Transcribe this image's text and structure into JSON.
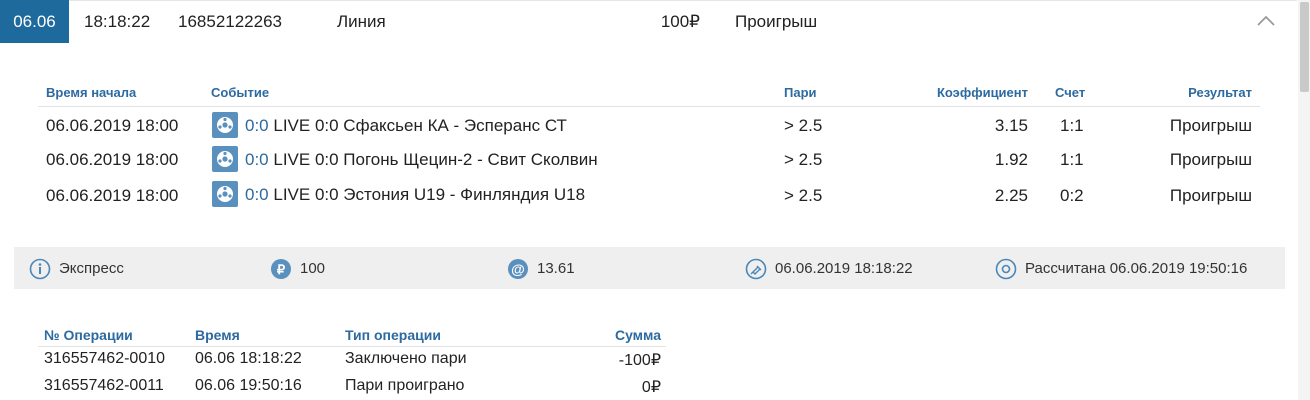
{
  "header": {
    "date": "06.06",
    "time": "18:18:22",
    "bet_id": "16852122263",
    "type": "Линия",
    "amount": "100₽",
    "result": "Проигрыш"
  },
  "events": {
    "columns": {
      "start": "Время начала",
      "event": "Событие",
      "bet": "Пари",
      "coef": "Коэффициент",
      "score": "Счет",
      "result": "Результат"
    },
    "rows": [
      {
        "start": "06.06.2019 18:00",
        "score_live": "0:0",
        "name": "LIVE 0:0 Сфаксьен КА - Эсперанс СТ",
        "bet": "> 2.5",
        "coef": "3.15",
        "score": "1:1",
        "result": "Проигрыш"
      },
      {
        "start": "06.06.2019 18:00",
        "score_live": "0:0",
        "name": "LIVE 0:0 Погонь Щецин-2 - Свит Сколвин",
        "bet": "> 2.5",
        "coef": "1.92",
        "score": "1:1",
        "result": "Проигрыш"
      },
      {
        "start": "06.06.2019 18:00",
        "score_live": "0:0",
        "name": "LIVE 0:0 Эстония U19 - Финляндия U18",
        "bet": "> 2.5",
        "coef": "2.25",
        "score": "0:2",
        "result": "Проигрыш"
      }
    ]
  },
  "summary": {
    "kind": "Экспресс",
    "stake": "100",
    "total_coef": "13.61",
    "placed": "06.06.2019 18:18:22",
    "settled": "Рассчитана 06.06.2019 19:50:16"
  },
  "operations": {
    "columns": {
      "id": "№ Операции",
      "time": "Время",
      "type": "Тип операции",
      "sum": "Сумма"
    },
    "rows": [
      {
        "id": "316557462-0010",
        "time": "06.06 18:18:22",
        "type": "Заключено пари",
        "sum": "-100₽"
      },
      {
        "id": "316557462-0011",
        "time": "06.06 19:50:16",
        "type": "Пари проиграно",
        "sum": "0₽"
      }
    ]
  },
  "colors": {
    "accent": "#1e6a9c",
    "link": "#2d6aa0",
    "summary_bg": "#efefef"
  },
  "icons": [
    "chevron-up-icon",
    "soccer-ball-icon",
    "info-icon",
    "ruble-icon",
    "at-icon",
    "pin-icon",
    "settled-icon"
  ]
}
